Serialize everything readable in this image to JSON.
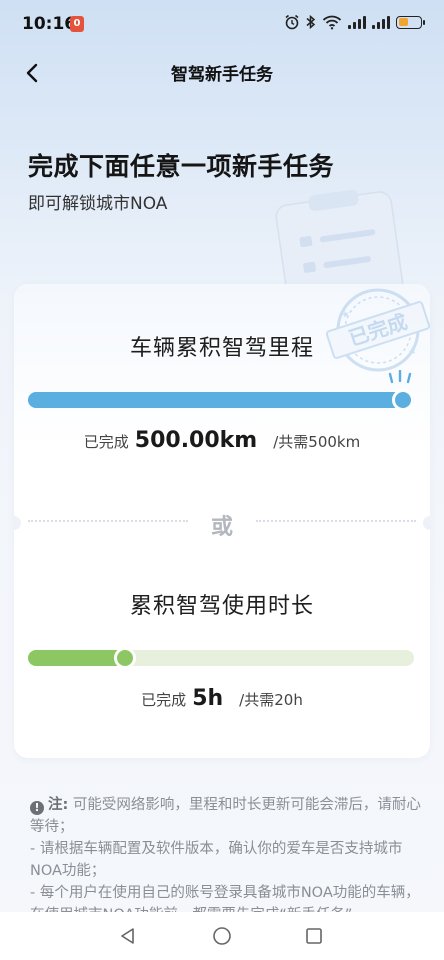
{
  "status_bar": {
    "time": "10:16",
    "notification_badge": "0",
    "icons": [
      "alarm-icon",
      "bluetooth-icon",
      "wifi-icon",
      "signal-icon",
      "signal-icon",
      "battery-icon"
    ],
    "battery_color": "#f0a531"
  },
  "nav": {
    "title": "智驾新手任务"
  },
  "hero": {
    "title": "完成下面任意一项新手任务",
    "subtitle": "即可解锁城市NOA"
  },
  "stamp": {
    "text": "已完成"
  },
  "tasks": [
    {
      "title": "车辆累积智驾里程",
      "done_label": "已完成",
      "value": "500.00km",
      "required": "/共需500km",
      "progress": 1.0,
      "color": "#5aaee0",
      "track_color": "#e4edf6"
    },
    {
      "title": "累积智驾使用时长",
      "done_label": "已完成",
      "value": "5h",
      "required": "/共需20h",
      "progress": 0.25,
      "color": "#8cc763",
      "track_color": "#e6f0dc"
    }
  ],
  "divider": {
    "text": "或"
  },
  "notes": {
    "heading": "注:",
    "lines": [
      "可能受网络影响，里程和时长更新可能会滞后，请耐心等待；",
      "- 请根据车辆配置及软件版本，确认你的爱车是否支持城市NOA功能；",
      "- 每个用户在使用自己的账号登录具备城市NOA功能的车辆，在使用城市NOA功能前，都需要先完成“新手任务”"
    ]
  },
  "system_nav": {
    "icons": [
      "back-triangle-icon",
      "home-circle-icon",
      "recents-square-icon"
    ]
  }
}
